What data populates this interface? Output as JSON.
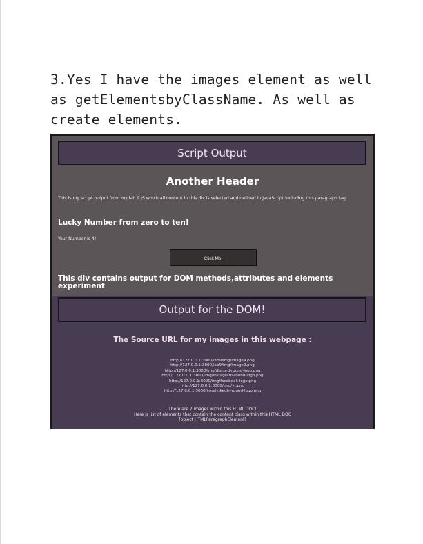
{
  "note_text": "3.Yes I have the images element as well as getElementsbyClassName. As well as create elements.",
  "screenshot": {
    "script_output_title": "Script Output",
    "another_header": "Another Header",
    "intro_paragraph": "This is my script output from my lab 9 JS which all content in this div is selected and defined in JavaScript including this paragraph tag.",
    "lucky_heading": "Lucky Number from zero to ten!",
    "your_number": "Your Number is 4!",
    "click_button": "Click Me!",
    "dom_div_text": "This div contains output for DOM methods,attributes and elements experiment",
    "dom_output_title": "Output for the DOM!",
    "source_title": "The Source URL for my images in this webpage :",
    "image_urls": [
      "http://127.0.0.1:3000/lab9/img/image4.png",
      "http://127.0.0.1:3000/lab9/img/image2.png",
      "http://127.0.0.1:3000/img/discord-round-logo.png",
      "http://127.0.0.1:3000/img/instagram-round-logo.png",
      "http://127.0.0.1:3000/img/facebook-logo.png",
      "http://127.0.0.1:3000/img/yt.png",
      "http://127.0.0.1:3000/img/linkedin-round-logo.png"
    ],
    "image_count_text": "There are 7 images within this HTML DOC!",
    "content_class_text": "Here is list of elements that contain the content class within this HTML DOC",
    "element_text": "[object HTMLParagraphElement]"
  },
  "colors": {
    "upper_background": "#5b5557",
    "panel_background": "#483c52",
    "button_background": "#353030"
  }
}
